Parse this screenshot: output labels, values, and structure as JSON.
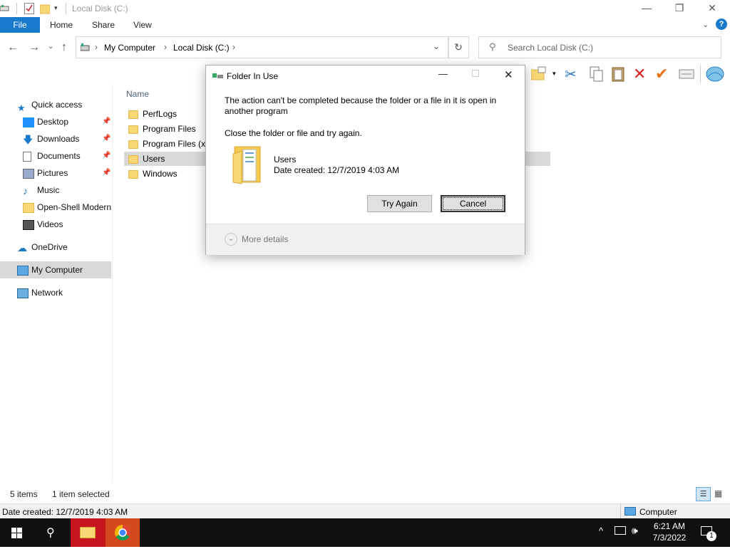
{
  "window": {
    "title": "Local Disk (C:)",
    "ribbon_tabs": [
      "File",
      "Home",
      "Share",
      "View"
    ]
  },
  "address": {
    "crumbs": [
      "My Computer",
      "Local Disk (C:)"
    ],
    "search_placeholder": "Search Local Disk (C:)"
  },
  "nav": {
    "quick_access": "Quick access",
    "items": [
      {
        "label": "Desktop",
        "pinned": true
      },
      {
        "label": "Downloads",
        "pinned": true
      },
      {
        "label": "Documents",
        "pinned": true
      },
      {
        "label": "Pictures",
        "pinned": true
      },
      {
        "label": "Music",
        "pinned": false
      },
      {
        "label": "Open-Shell Modern",
        "pinned": false
      },
      {
        "label": "Videos",
        "pinned": false
      }
    ],
    "onedrive": "OneDrive",
    "my_computer": "My Computer",
    "network": "Network"
  },
  "files": {
    "column_name": "Name",
    "rows": [
      {
        "name": "PerfLogs",
        "selected": false
      },
      {
        "name": "Program Files",
        "selected": false
      },
      {
        "name": "Program Files (x86)",
        "selected": false
      },
      {
        "name": "Users",
        "selected": true
      },
      {
        "name": "Windows",
        "selected": false
      }
    ]
  },
  "status": {
    "count": "5 items",
    "selection": "1 item selected",
    "details": "Date created: 12/7/2019 4:03 AM",
    "location": "Computer"
  },
  "dialog": {
    "title": "Folder In Use",
    "message": "The action can't be completed because the folder or a file in it is open in another program",
    "instruction": "Close the folder or file and try again.",
    "item_name": "Users",
    "item_date": "Date created: 12/7/2019 4:03 AM",
    "try_again": "Try Again",
    "cancel": "Cancel",
    "more_details": "More details"
  },
  "taskbar": {
    "time": "6:21 AM",
    "date": "7/3/2022",
    "notification_count": "1"
  },
  "colors": {
    "accent": "#1979ca",
    "selection": "#d9d9d9",
    "taskbar": "#101010",
    "folder": "#f8d775"
  }
}
